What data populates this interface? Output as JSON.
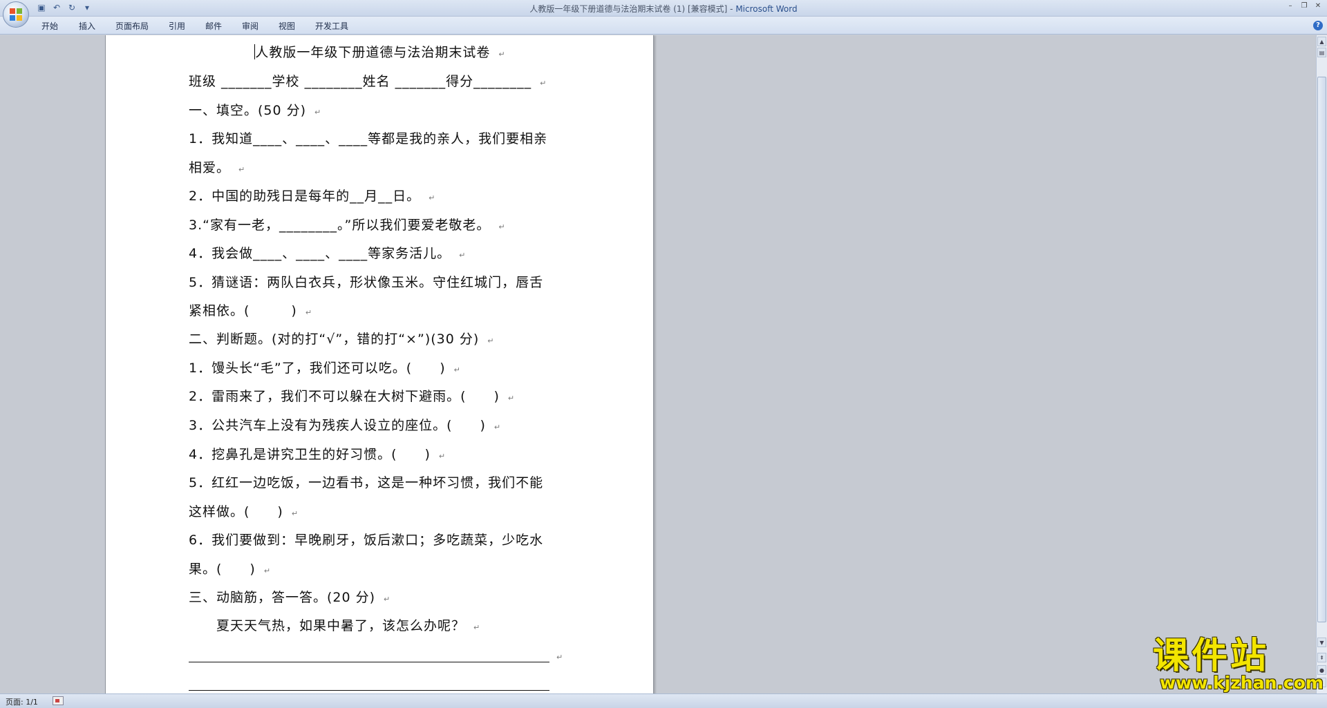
{
  "window": {
    "title_doc": "人教版一年级下册道德与法治期末试卷 (1) [兼容模式] - ",
    "title_app": "Microsoft Word"
  },
  "ribbon": {
    "tabs": [
      "开始",
      "插入",
      "页面布局",
      "引用",
      "邮件",
      "审阅",
      "视图",
      "开发工具"
    ]
  },
  "document": {
    "title": "人教版一年级下册道德与法治期末试卷",
    "lines": [
      "班级 _______学校 ________姓名 _______得分________",
      "一、填空。(50 分)",
      "1．我知道____、____、____等都是我的亲人，我们要相亲",
      "相爱。",
      "2．中国的助残日是每年的__月__日。",
      "3.“家有一老，________。”所以我们要爱老敬老。",
      "4．我会做____、____、____等家务活儿。",
      "5．猜谜语：两队白衣兵，形状像玉米。守住红城门，唇舌",
      "紧相依。(　　　)",
      "二、判断题。(对的打“√”，错的打“×”)(30 分)",
      "1．馒头长“毛”了，我们还可以吃。(　　)",
      "2．雷雨来了，我们不可以躲在大树下避雨。(　　)",
      "3．公共汽车上没有为残疾人设立的座位。(　　)",
      "4．挖鼻孔是讲究卫生的好习惯。(　　)",
      "5．红红一边吃饭，一边看书，这是一种坏习惯，我们不能",
      "这样做。(　　)",
      "6．我们要做到：早晚刷牙，饭后漱口；多吃蔬菜，少吃水",
      "果。(　　)",
      "三、动脑筋，答一答。(20 分)",
      "　　夏天天气热，如果中暑了，该怎么办呢？"
    ],
    "paragraph_mark": "↵"
  },
  "status": {
    "page": "页面: 1/1"
  },
  "watermark": {
    "cn": "课件站",
    "url": "www.kjzhan.com"
  }
}
